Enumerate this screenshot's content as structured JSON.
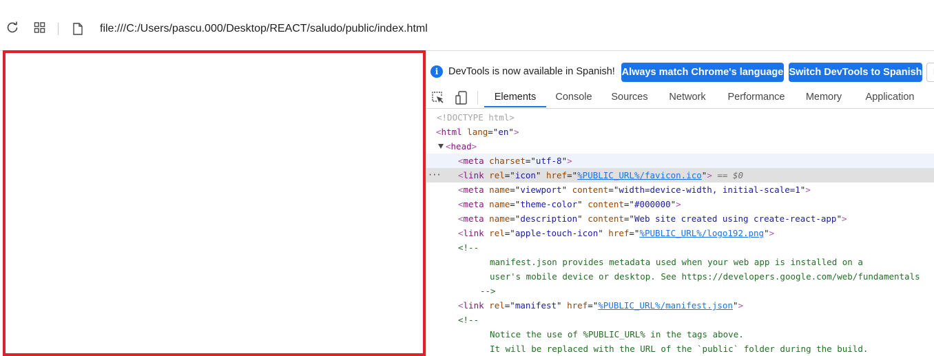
{
  "addressbar": {
    "url": "file:///C:/Users/pascu.000/Desktop/REACT/saludo/public/index.html"
  },
  "devtools": {
    "infobar": {
      "message": "DevTools is now available in Spanish!",
      "btn_match": "Always match Chrome's language",
      "btn_switch": "Switch DevTools to Spanish",
      "btn_more": "D"
    },
    "tabs": [
      "Elements",
      "Console",
      "Sources",
      "Network",
      "Performance",
      "Memory",
      "Application"
    ],
    "active_tab": "Elements",
    "tree": {
      "doctype": "<!DOCTYPE html>",
      "html_tag": "html",
      "html_lang_attr": "lang",
      "html_lang_val": "en",
      "head_tag": "head",
      "meta_charset": {
        "tag": "meta",
        "attr": "charset",
        "val": "utf-8"
      },
      "link_icon": {
        "tag": "link",
        "a1": "rel",
        "v1": "icon",
        "a2": "href",
        "v2": "%PUBLIC_URL%/favicon.ico",
        "suffix": "== $0"
      },
      "meta_viewport": {
        "tag": "meta",
        "a1": "name",
        "v1": "viewport",
        "a2": "content",
        "v2": "width=device-width, initial-scale=1"
      },
      "meta_theme": {
        "tag": "meta",
        "a1": "name",
        "v1": "theme-color",
        "a2": "content",
        "v2": "#000000"
      },
      "meta_desc": {
        "tag": "meta",
        "a1": "name",
        "v1": "description",
        "a2": "content",
        "v2": "Web site created using create-react-app"
      },
      "link_apple": {
        "tag": "link",
        "a1": "rel",
        "v1": "apple-touch-icon",
        "a2": "href",
        "v2": "%PUBLIC_URL%/logo192.png"
      },
      "comment_open": "<!--",
      "comment1_line1": "manifest.json provides metadata used when your web app is installed on a",
      "comment1_line2": "user's mobile device or desktop. See https://developers.google.com/web/fundamentals",
      "comment_close": "-->",
      "link_manifest": {
        "tag": "link",
        "a1": "rel",
        "v1": "manifest",
        "a2": "href",
        "v2": "%PUBLIC_URL%/manifest.json"
      },
      "comment2_line1": "Notice the use of %PUBLIC_URL% in the tags above.",
      "comment2_line2": "It will be replaced with the URL of the `public` folder during the build."
    }
  },
  "colors": {
    "highlight_border": "#e0202a",
    "accent": "#1a73e8"
  },
  "icons": {
    "reload": "reload-icon",
    "apps": "apps-grid-icon",
    "file": "file-icon",
    "info": "info-icon",
    "inspect": "inspect-element-icon",
    "device": "device-toolbar-icon"
  }
}
